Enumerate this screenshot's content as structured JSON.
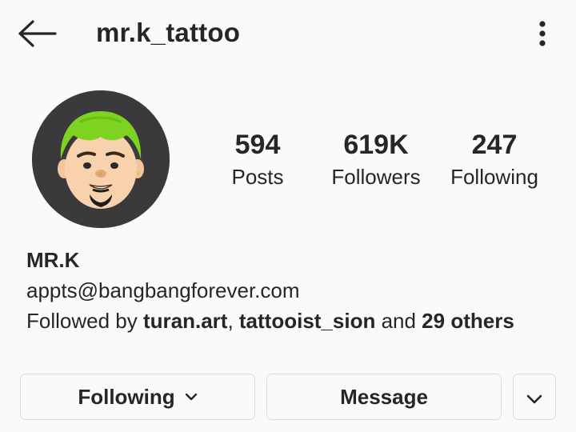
{
  "header": {
    "username": "mr.k_tattoo",
    "back_icon": "arrow-left-icon",
    "more_icon": "more-vertical-icon"
  },
  "profile": {
    "avatar_icon": "memoji-avatar",
    "stats": {
      "posts": {
        "value": "594",
        "label": "Posts"
      },
      "followers": {
        "value": "619K",
        "label": "Followers"
      },
      "following": {
        "value": "247",
        "label": "Following"
      }
    }
  },
  "bio": {
    "name": "MR.K",
    "email": "appts@bangbangforever.com",
    "followed_by_prefix": "Followed by ",
    "followed_by_user1": "turan.art",
    "followed_by_sep": ", ",
    "followed_by_user2": "tattooist_sion",
    "followed_by_and": " and ",
    "followed_by_others": "29 others"
  },
  "actions": {
    "following_label": "Following",
    "message_label": "Message",
    "suggest_icon": "chevron-down-icon"
  },
  "colors": {
    "background": "#fafafa",
    "text": "#262626",
    "border": "#dbdbdb",
    "avatar_bg": "#3a3a3d",
    "hair": "#7ed321"
  }
}
